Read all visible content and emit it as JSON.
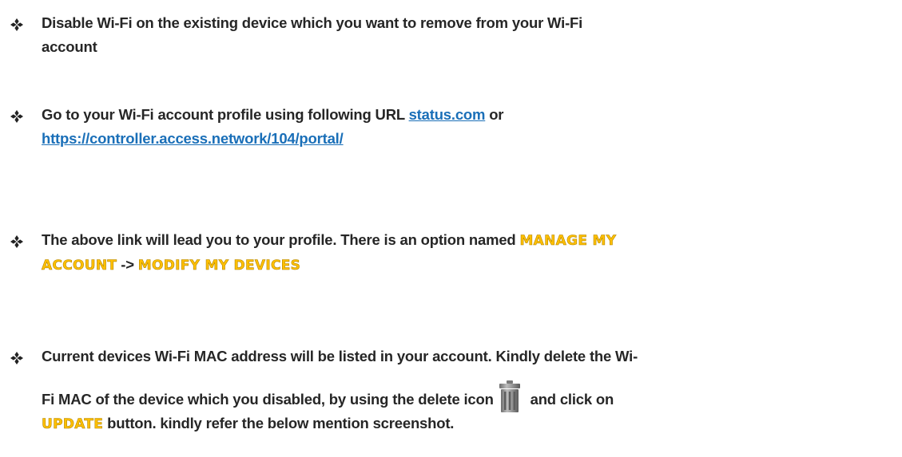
{
  "colors": {
    "text": "#262626",
    "link": "#1a6fb8",
    "keyword_fill": "#ffc000",
    "keyword_outline": "#b38600",
    "bullet": "#222222"
  },
  "bullet_icon": "four-diamond-bullet-icon",
  "items": [
    {
      "line1": "Disable Wi-Fi on the existing device which you want to remove from your Wi-Fi",
      "line2": "account"
    },
    {
      "pre": "Go to your Wi-Fi account profile using following URL ",
      "link1": "status.com",
      "mid": " or",
      "link2": "https://controller.access.network/104/portal/"
    },
    {
      "pre": "The above link will lead you to your profile. There is an option named ",
      "kw1": "MANAGE MY",
      "kw2": "ACCOUNT",
      "arrow": " -> ",
      "kw3": "MODIFY MY DEVICES"
    },
    {
      "line1": "Current devices Wi-Fi MAC address will be listed in your account.  Kindly delete the Wi-",
      "line2_pre": "Fi MAC of the device which you disabled, by using the delete icon ",
      "line2_post": " and click on",
      "kw": "UPDATE",
      "line3_post": " button. kindly refer the below mention screenshot.",
      "icon": "trash-icon"
    }
  ]
}
